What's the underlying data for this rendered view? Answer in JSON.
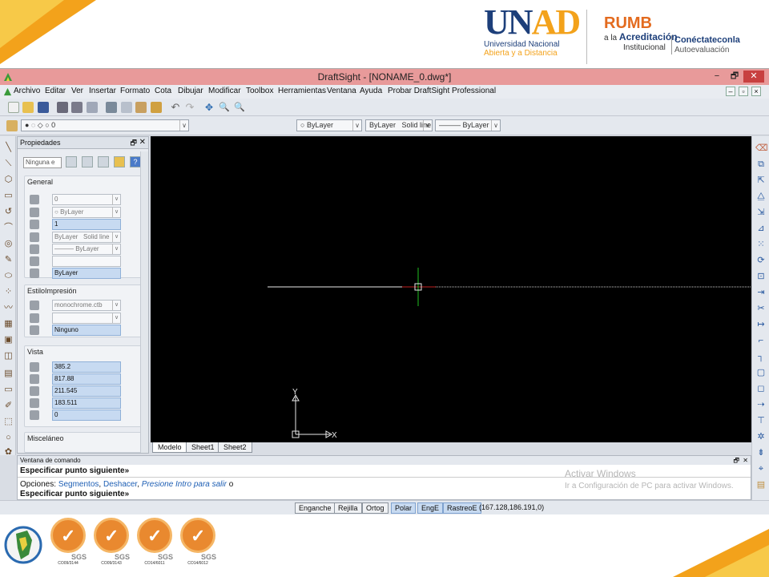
{
  "window": {
    "title": "DraftSight - [NONAME_0.dwg*]",
    "minimize": "−",
    "restore": "🗗",
    "close": "✕"
  },
  "menu": [
    "Archivo",
    "Editar",
    "Ver",
    "Insertar",
    "Formato",
    "Cota",
    "Dibujar",
    "Modificar",
    "Toolbox",
    "Herramientas",
    "Ventana",
    "Ayuda",
    "Probar DraftSight Professional"
  ],
  "layer_toolbar": {
    "layer_value": "0",
    "color_value": "ByLayer",
    "linestyle_value": "ByLayer",
    "linestyle_type": "Solid line",
    "lineweight_value": "——— ByLayer"
  },
  "properties": {
    "title": "Propiedades",
    "selector": "Ninguna e",
    "general": {
      "title": "General",
      "layer": "0",
      "color": "ByLayer",
      "linescale": "1",
      "linestyle": "ByLayer",
      "linestyle_type": "Solid line",
      "lineweight": "——— ByLayer",
      "transparency": "",
      "transparency_mode": "ByLayer"
    },
    "print_style": {
      "title": "EstiloImpresión",
      "table": "monochrome.ctb",
      "style": "",
      "attached": "Ninguno"
    },
    "view": {
      "title": "Vista",
      "height": "385.2",
      "width": "817.88",
      "center_x": "211.545",
      "center_y": "183.511",
      "center_z": "0"
    },
    "misc": {
      "title": "Misceláneo"
    }
  },
  "canvas": {
    "axis_y": "Y",
    "axis_x": "X"
  },
  "tabs": [
    "Modelo",
    "Sheet1",
    "Sheet2"
  ],
  "command": {
    "title": "Ventana de comando",
    "line1": "Especificar punto siguiente»",
    "options_label": "Opciones:",
    "opt_segmentos": "Segmentos",
    "opt_deshacer": "Deshacer",
    "opt_exit": "Presione Intro para salir",
    "opt_suffix": "o",
    "line3": "Especificar punto siguiente»"
  },
  "watermark": {
    "line1": "Activar Windows",
    "line2": "Ir a Configuración de PC para activar Windows."
  },
  "status": {
    "buttons": [
      {
        "label": "Enganche",
        "on": false
      },
      {
        "label": "Rejilla",
        "on": false
      },
      {
        "label": "Ortog",
        "on": false
      },
      {
        "label": "Polar",
        "on": true
      },
      {
        "label": "EngE",
        "on": true
      },
      {
        "label": "RastreoE",
        "on": true
      }
    ],
    "coords": "(167.128,186.191,0)"
  },
  "branding": {
    "unad_word_a": "UN",
    "unad_word_b": "AD",
    "unad_line1": "Universidad Nacional",
    "unad_line2": "Abierta y a  Distancia",
    "rumbo": "RUMB",
    "rumbo_line1_a": "a la",
    "rumbo_line1_b": "Acreditación",
    "rumbo_line2": "Institucional",
    "conect_1": "Conéctateconla",
    "conect_2": "Autoevaluación"
  },
  "certs": [
    {
      "code": "CO09/3144",
      "sgs": "SGS"
    },
    {
      "code": "CO09/3143",
      "sgs": "SGS"
    },
    {
      "code": "CO14/6011",
      "sgs": "SGS"
    },
    {
      "code": "CO14/6012",
      "sgs": "SGS"
    }
  ],
  "colors": {
    "titlebar": "#e89a9a",
    "canvas": "#000000",
    "accent_orange": "#f3a21b",
    "unad_blue": "#1d3f7a"
  }
}
